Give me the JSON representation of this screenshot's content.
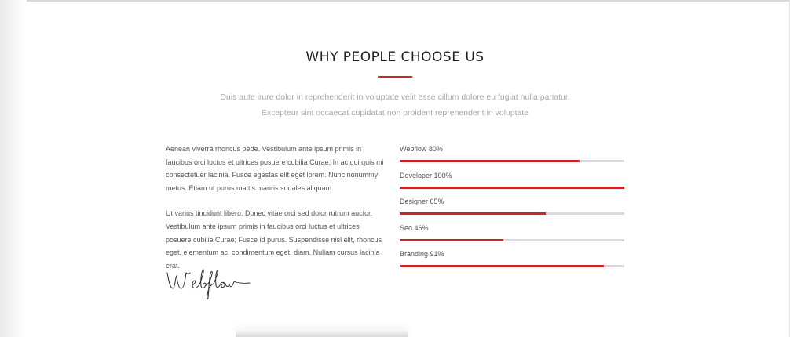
{
  "section": {
    "title": "WHY PEOPLE CHOOSE US",
    "intro_line_1": "Duis aute irure dolor in reprehenderit in voluptate velit esse cillum dolore eu fugiat nulla pariatur.",
    "intro_line_2": "Excepteur sint occaecat cupidatat non proident reprehenderit in voluptate"
  },
  "text": {
    "paragraph_1": "Aenean viverra rhoncus pede. Vestibulum ante ipsum primis in faucibus orci luctus et ultrices posuere cubilia Curae; In ac dui quis mi consectetuer lacinia. Fusce egestas elit eget lorem. Nunc nonummy metus. Etiam ut purus mattis mauris sodales aliquam.",
    "paragraph_2": "Ut varius tincidunt libero. Donec vitae orci sed dolor rutrum auctor. Vestibulum ante ipsum primis in faucibus orci luctus et ultrices posuere cubilia Curae; Fusce id purus. Suspendisse nisl elit, rhoncus eget, elementum ac, condimentum eget, diam. Nullam cursus lacinia erat.",
    "signature": "Webflow"
  },
  "skills": [
    {
      "label": "Webflow 80%",
      "percent": 80
    },
    {
      "label": "Developer 100%",
      "percent": 100
    },
    {
      "label": "Designer 65%",
      "percent": 65
    },
    {
      "label": "Seo 46%",
      "percent": 46
    },
    {
      "label": "Branding 91%",
      "percent": 91
    }
  ],
  "colors": {
    "accent": "#c62828",
    "track": "#dadada",
    "heading": "#1e1e1e",
    "muted_text": "#a7a7a7",
    "body_text": "#545454"
  }
}
